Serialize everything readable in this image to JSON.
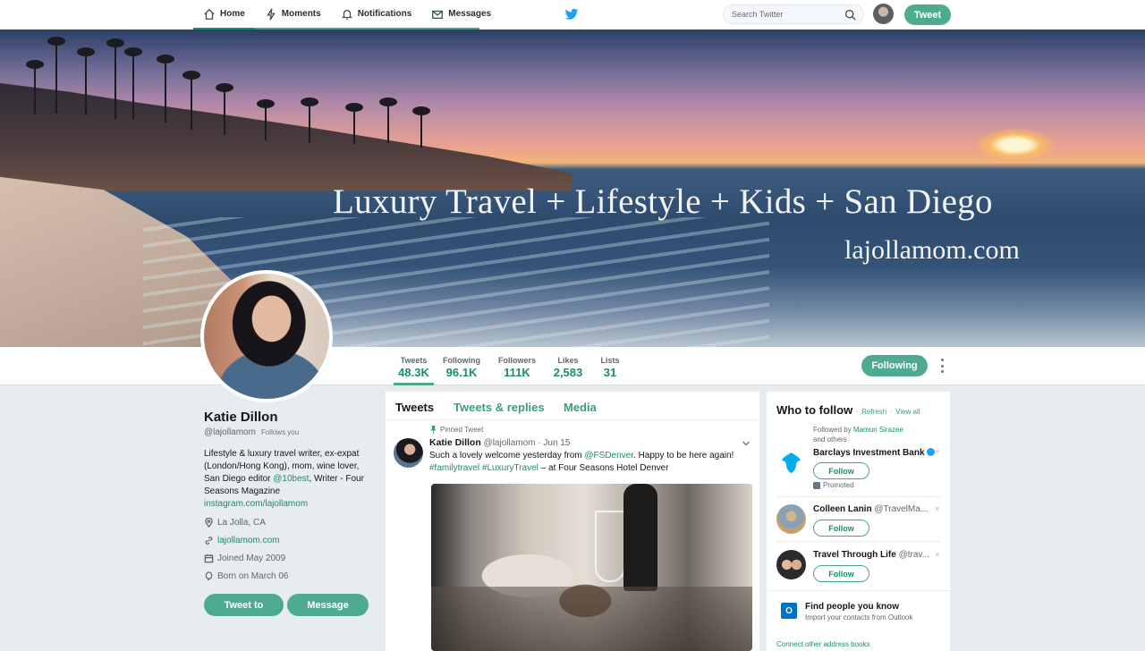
{
  "nav": {
    "home": "Home",
    "moments": "Moments",
    "notifications": "Notifications",
    "messages": "Messages",
    "search_placeholder": "Search Twitter",
    "tweet_button": "Tweet"
  },
  "banner": {
    "title": "Luxury Travel + Lifestyle + Kids + San Diego",
    "site": "lajollamom.com"
  },
  "stats": [
    {
      "label": "Tweets",
      "value": "48.3K"
    },
    {
      "label": "Following",
      "value": "96.1K"
    },
    {
      "label": "Followers",
      "value": "111K"
    },
    {
      "label": "Likes",
      "value": "2,583"
    },
    {
      "label": "Lists",
      "value": "31"
    }
  ],
  "profile": {
    "following_button": "Following",
    "name": "Katie Dillon",
    "handle": "@lajollamom",
    "follows_you": "Follows you",
    "bio_part1": "Lifestyle & luxury travel writer, ex-expat (London/Hong Kong), mom, wine lover, San Diego editor ",
    "bio_link1": "@10best",
    "bio_part2": ", Writer - Four Seasons Magazine",
    "bio_link2": "instagram.com/lajollamom",
    "location": "La Jolla, CA",
    "website": "lajollamom.com",
    "joined": "Joined May 2009",
    "born": "Born on March 06",
    "tweet_to": "Tweet to",
    "message": "Message"
  },
  "timeline": {
    "tabs": [
      "Tweets",
      "Tweets & replies",
      "Media"
    ],
    "pinned_label": "Pinned Tweet",
    "tweet": {
      "name": "Katie Dillon",
      "handle": "@lajollamom",
      "date": "· Jun 15",
      "text_part1": "Such a lovely welcome yesterday from ",
      "mention": "@FSDenver",
      "text_part2": ". Happy to be here again! ",
      "hashtags": "#familytravel #LuxuryTravel",
      "text_part3": " – at Four Seasons Hotel Denver"
    }
  },
  "who_to_follow": {
    "title": "Who to follow",
    "refresh": "Refresh",
    "view_all": "View all",
    "dot": "·",
    "followed_by_prefix": "Followed by ",
    "followed_by_name": "Mamun Sirazee",
    "followed_by_suffix": "and others",
    "suggestions": [
      {
        "name": "Barclays Investment Bank",
        "handle": "",
        "follow": "Follow",
        "promoted": "Promoted"
      },
      {
        "name": "Colleen Lanin",
        "handle": "@TravelMa...",
        "follow": "Follow"
      },
      {
        "name": "Travel Through Life",
        "handle": "@trav...",
        "follow": "Follow"
      }
    ],
    "close_glyph": "×",
    "find_people_title": "Find people you know",
    "find_people_sub": "Import your contacts from Outlook",
    "outlook_glyph": "O",
    "connect_link": "Connect other address books"
  }
}
